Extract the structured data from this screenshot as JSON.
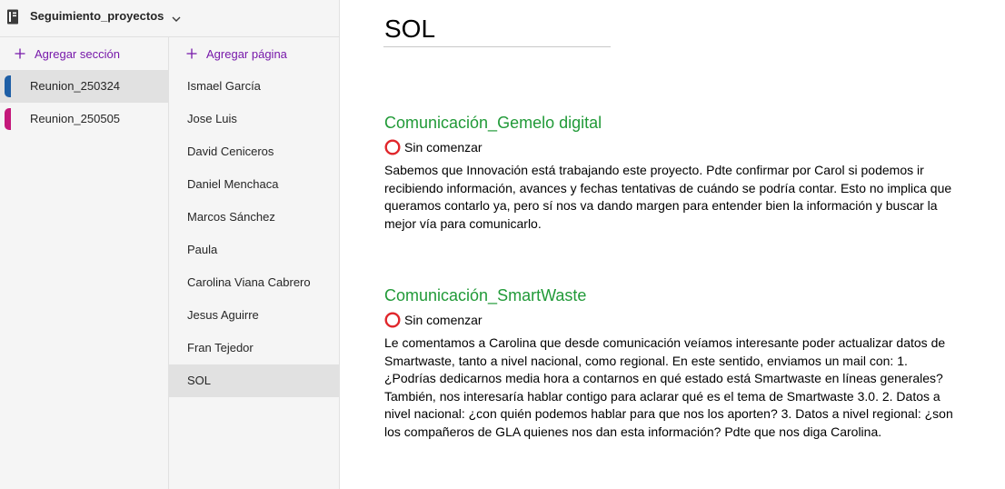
{
  "notebook": {
    "title": "Seguimiento_proyectos",
    "icon": "notebook-icon",
    "dropdown_icon": "chevron-down-icon"
  },
  "sections": {
    "add_label": "Agregar sección",
    "items": [
      {
        "label": "Reunion_250324",
        "color": "#1f5fa6",
        "selected": true
      },
      {
        "label": "Reunion_250505",
        "color": "#c4187a",
        "selected": false
      }
    ]
  },
  "pages": {
    "add_label": "Agregar página",
    "items": [
      {
        "label": "Ismael García",
        "selected": false
      },
      {
        "label": "Jose Luis",
        "selected": false
      },
      {
        "label": "David Ceniceros",
        "selected": false
      },
      {
        "label": "Daniel Menchaca",
        "selected": false
      },
      {
        "label": "Marcos Sánchez",
        "selected": false
      },
      {
        "label": "Paula",
        "selected": false
      },
      {
        "label": "Carolina Viana Cabrero",
        "selected": false
      },
      {
        "label": "Jesus Aguirre",
        "selected": false
      },
      {
        "label": "Fran Tejedor",
        "selected": false
      },
      {
        "label": "SOL",
        "selected": true
      }
    ]
  },
  "content": {
    "title": "SOL",
    "blocks": [
      {
        "heading": "Comunicación_Gemelo digital",
        "status": "Sin comenzar",
        "status_icon": "red-circle-icon",
        "body": "Sabemos que Innovación está trabajando este proyecto. Pdte confirmar por Carol si podemos ir recibiendo información, avances y fechas tentativas de cuándo se podría contar. Esto no implica que queramos contarlo ya, pero sí nos va dando margen para entender bien la información y buscar la mejor vía para comunicarlo."
      },
      {
        "heading": "Comunicación_SmartWaste",
        "status": "Sin comenzar",
        "status_icon": "red-circle-icon",
        "body": "Le comentamos a Carolina que desde comunicación veíamos interesante poder actualizar datos de Smartwaste, tanto a nivel nacional, como regional. En este sentido, enviamos un mail con: 1. ¿Podrías dedicarnos media hora a contarnos en qué estado está Smartwaste en líneas generales? También, nos interesaría hablar contigo para aclarar qué es el tema de Smartwaste 3.0. 2. Datos a nivel nacional: ¿con quién podemos hablar para que nos los aporten? 3. Datos a nivel regional: ¿son los compañeros de GLA quienes nos dan esta información? Pdte que nos diga Carolina."
      }
    ]
  },
  "colors": {
    "accent": "#7719aa",
    "heading_green": "#219a38",
    "status_red": "#e0262b",
    "pane_bg": "#f5f5f5",
    "selected_bg": "#e1e1e1"
  }
}
